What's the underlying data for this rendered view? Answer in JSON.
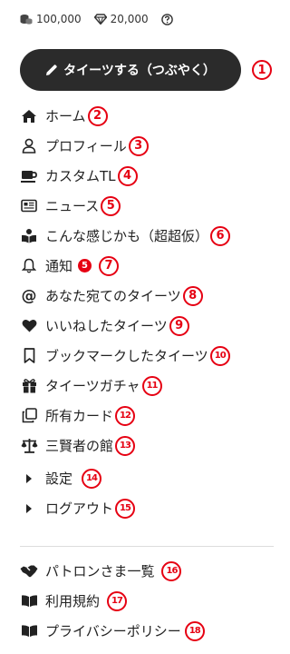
{
  "wallet": {
    "coins": "100,000",
    "gems": "20,000"
  },
  "post_button": {
    "label": "タイーツする（つぶやく）"
  },
  "menu": [
    {
      "label": "ホーム",
      "marker": "2"
    },
    {
      "label": "プロフィール",
      "marker": "3"
    },
    {
      "label": "カスタムTL",
      "marker": "4"
    },
    {
      "label": "ニュース",
      "marker": "5"
    },
    {
      "label": "こんな感じかも（超超仮）",
      "marker": "6"
    },
    {
      "label": "通知",
      "badge": "5",
      "marker": "7"
    },
    {
      "label": "あなた宛てのタイーツ",
      "marker": "8"
    },
    {
      "label": "いいねしたタイーツ",
      "marker": "9"
    },
    {
      "label": "ブックマークしたタイーツ",
      "marker": "10"
    },
    {
      "label": "タイーツガチャ",
      "marker": "11"
    },
    {
      "label": "所有カード",
      "marker": "12"
    },
    {
      "label": "三賢者の館",
      "marker": "13"
    },
    {
      "label": "設定",
      "marker": "14"
    },
    {
      "label": "ログアウト",
      "marker": "15"
    }
  ],
  "footer": [
    {
      "label": "パトロンさま一覧",
      "marker": "16"
    },
    {
      "label": "利用規約",
      "marker": "17"
    },
    {
      "label": "プライバシーポリシー",
      "marker": "18"
    }
  ],
  "post_marker": "1",
  "colors": {
    "accent_red": "#e60012",
    "button_dark": "#2b2b2b"
  }
}
